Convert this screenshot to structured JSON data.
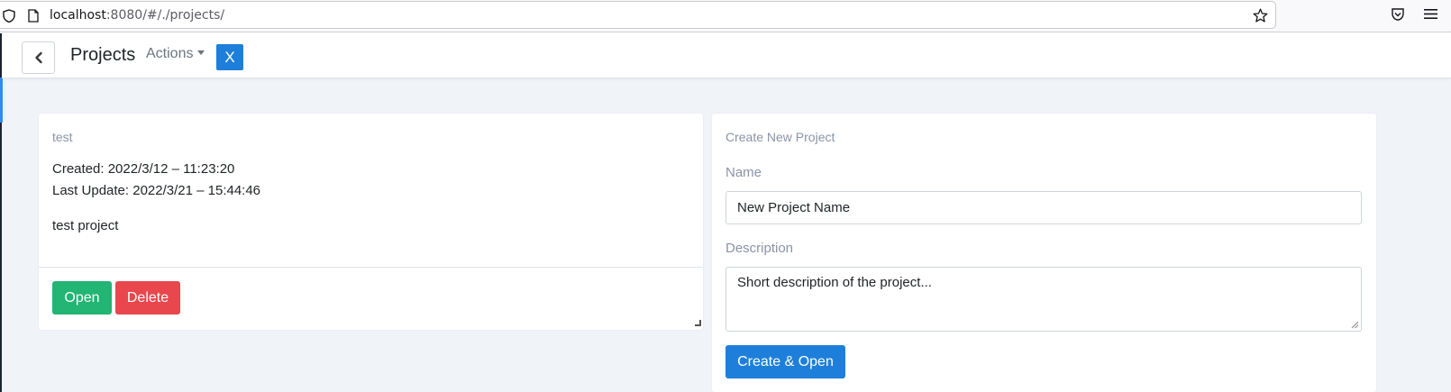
{
  "browser": {
    "url_host": "localhost",
    "url_rest": ":8080/#/./projects/"
  },
  "navbar": {
    "title": "Projects",
    "actions_label": "Actions",
    "close_label": "X"
  },
  "project_card": {
    "name": "test",
    "created": "Created: 2022/3/12 – 11:23:20",
    "updated": "Last Update: 2022/3/21 – 15:44:46",
    "description": "test project",
    "open_label": "Open",
    "delete_label": "Delete"
  },
  "create_card": {
    "title": "Create New Project",
    "name_label": "Name",
    "name_value": "New Project Name",
    "description_label": "Description",
    "description_value": "Short description of the project...",
    "submit_label": "Create & Open"
  },
  "colors": {
    "primary": "#1e7fdb",
    "success": "#22b573",
    "danger": "#e8474d",
    "background": "#f0f3f8"
  }
}
